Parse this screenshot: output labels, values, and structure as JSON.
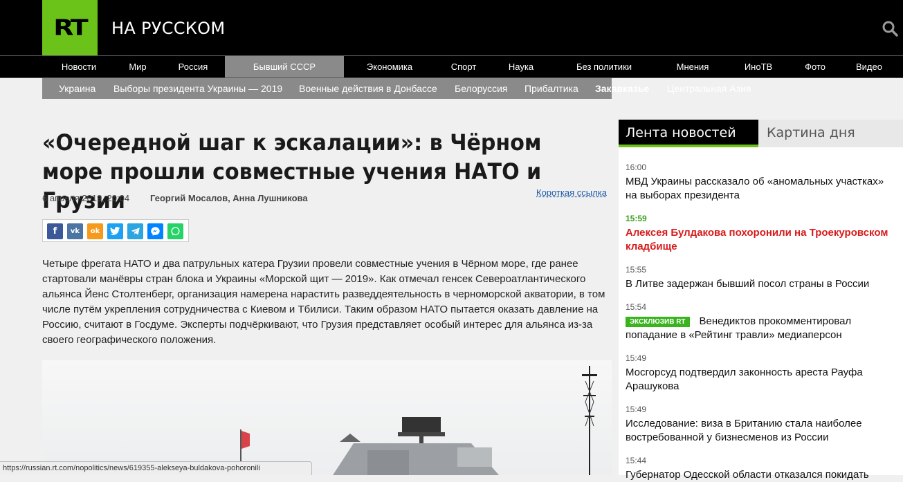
{
  "header": {
    "logo": "RT",
    "site_title": "НА РУССКОМ"
  },
  "main_nav": [
    "Новости",
    "Мир",
    "Россия",
    "Бывший СССР",
    "Экономика",
    "Спорт",
    "Наука",
    "Без политики",
    "Мнения",
    "ИноТВ",
    "Фото",
    "Видео"
  ],
  "main_nav_active": "Бывший СССР",
  "sub_nav": [
    "Украина",
    "Выборы президента Украины — 2019",
    "Военные действия в Донбассе",
    "Белоруссия",
    "Прибалтика",
    "Закавказье",
    "Центральная Азия"
  ],
  "sub_nav_active": "Закавказье",
  "article": {
    "headline": "«Очередной шаг к эскалации»: в Чёрном море прошли совместные учения НАТО и Грузии",
    "date": "6 апреля 2019, 20:04",
    "authors": "Георгий Мосалов, Анна Лушникова",
    "short_link": "Короткая ссылка",
    "lead": "Четыре фрегата НАТО и два патрульных катера Грузии провели совместные учения в Чёрном море, где ранее стартовали манёвры стран блока и Украины «Морской щит — 2019». Как отмечал генсек Североатлантического альянса Йенс Столтенберг, организация намерена нарастить разведдеятельность в черноморской акватории, в том числе путём укрепления сотрудничества с Киевом и Тбилиси. Таким образом НАТО пытается оказать давление на Россию, считают в Госдуме. Эксперты подчёркивают, что Грузия представляет особый интерес для альянса из-за своего географического положения."
  },
  "share_buttons": [
    {
      "icon": "facebook-icon",
      "glyph": "f",
      "color": "#3b5998"
    },
    {
      "icon": "vk-icon",
      "glyph": "vk",
      "color": "#4c75a3"
    },
    {
      "icon": "odnoklassniki-icon",
      "glyph": "ok",
      "color": "#f59a1b"
    },
    {
      "icon": "twitter-icon",
      "glyph": "t",
      "color": "#1da1f2"
    },
    {
      "icon": "telegram-icon",
      "glyph": "➤",
      "color": "#2ca5e0"
    },
    {
      "icon": "messenger-icon",
      "glyph": "m",
      "color": "#0084ff"
    },
    {
      "icon": "whatsapp-icon",
      "glyph": "w",
      "color": "#25d366"
    }
  ],
  "sidebar": {
    "tab_active": "Лента новостей",
    "tab_inactive": "Картина дня",
    "items": [
      {
        "time": "16:00",
        "text": "МВД Украины рассказало об «аномальных участках» на выборах президента"
      },
      {
        "time": "15:59",
        "text": "Алексея Булдакова похоронили на Троекуровском кладбище",
        "highlight": true
      },
      {
        "time": "15:55",
        "text": "В Литве задержан бывший посол страны в России"
      },
      {
        "time": "15:54",
        "badge": "ЭКСКЛЮЗИВ RT",
        "text": "Венедиктов прокомментировал попадание в «Рейтинг травли» медиаперсон"
      },
      {
        "time": "15:49",
        "text": "Мосгорсуд подтвердил законность ареста Рауфа Арашукова"
      },
      {
        "time": "15:49",
        "text": "Исследование: виза в Британию стала наиболее востребованной у бизнесменов из России"
      },
      {
        "time": "15:44",
        "text": "Губернатор Одесской области отказался покидать"
      }
    ]
  },
  "status_url": "https://russian.rt.com/nopolitics/news/619355-alekseya-buldakova-pohoronili",
  "colors": {
    "brand_green": "#6bc31a",
    "highlight_red": "#d71a1a",
    "nav_gray": "#8a8a8a"
  }
}
